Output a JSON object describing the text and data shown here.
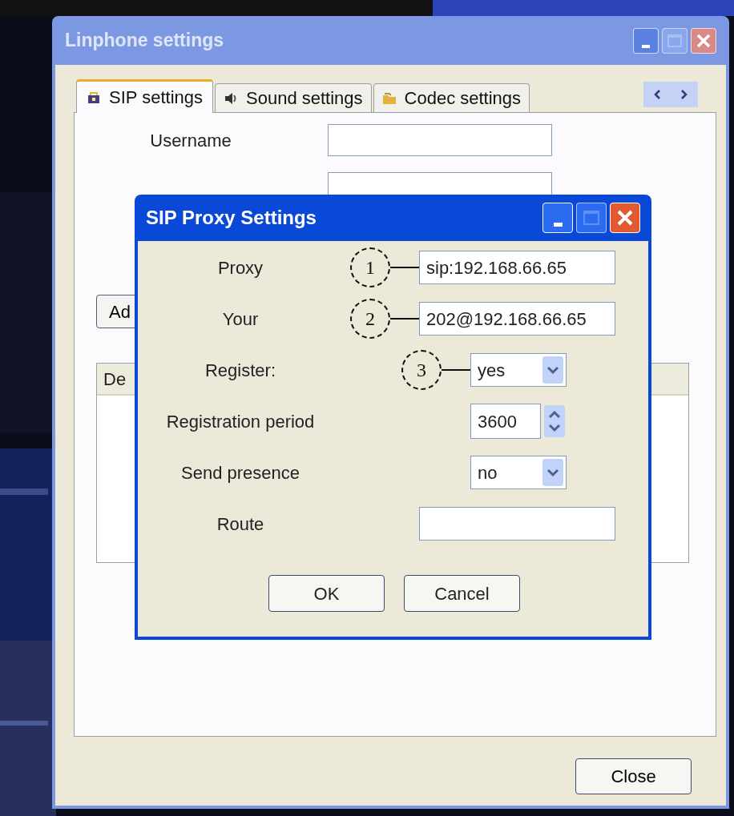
{
  "settings_window": {
    "title": "Linphone settings",
    "close_button": "Close"
  },
  "tabs": [
    {
      "label": "SIP settings",
      "kind": "sip",
      "selected": true
    },
    {
      "label": "Sound settings",
      "kind": "sound",
      "selected": false
    },
    {
      "label": "Codec settings",
      "kind": "codec",
      "selected": false
    }
  ],
  "sip_panel": {
    "fields": [
      {
        "kind": "labeled",
        "label": "Username"
      },
      {
        "kind": "covered"
      }
    ],
    "add_button": "Ad",
    "list": {
      "columns": [
        "De"
      ]
    }
  },
  "proxy_dialog": {
    "title": "SIP Proxy Settings",
    "rows": [
      {
        "kind": "text",
        "label": "Proxy",
        "value": "sip:192.168.66.65",
        "callout": "1"
      },
      {
        "kind": "text",
        "label": "Your",
        "value": "202@192.168.66.65",
        "callout": "2"
      },
      {
        "kind": "select",
        "label": "Register:",
        "value": "yes",
        "callout": "3"
      },
      {
        "kind": "spin",
        "label": "Registration period",
        "value": "3600"
      },
      {
        "kind": "select",
        "label": "Send presence",
        "value": "no"
      },
      {
        "kind": "text",
        "label": "Route"
      }
    ],
    "buttons": [
      "OK",
      "Cancel"
    ]
  }
}
